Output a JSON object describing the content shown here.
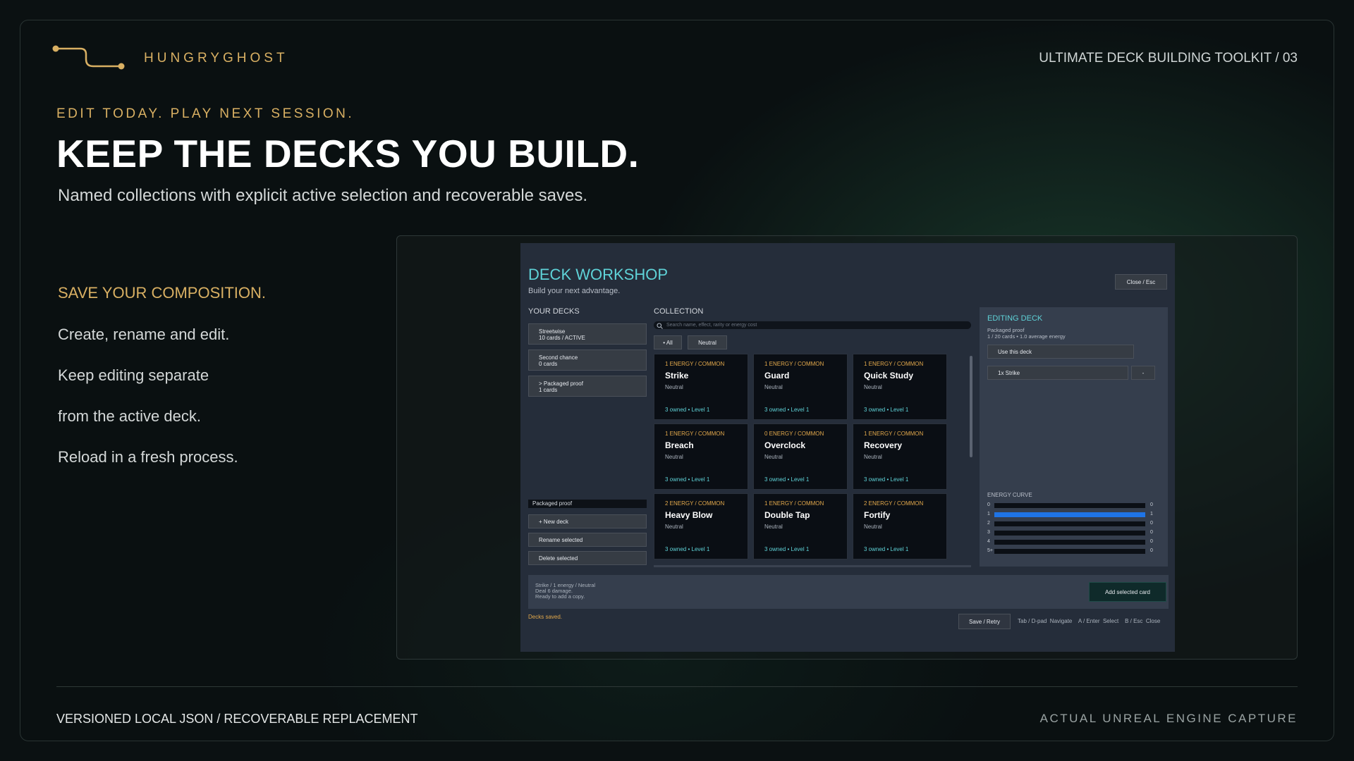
{
  "brand": {
    "name": "HUNGRYGHOST",
    "accent": "#d9b063"
  },
  "header": {
    "toolkit": "ULTIMATE DECK BUILDING TOOLKIT / 03"
  },
  "hero": {
    "eyebrow": "EDIT TODAY. PLAY NEXT SESSION.",
    "headline": "KEEP THE DECKS YOU BUILD.",
    "subhead": "Named collections with explicit active selection and recoverable saves."
  },
  "features": {
    "label": "SAVE YOUR COMPOSITION.",
    "items": [
      "Create, rename and edit.",
      "Keep editing separate",
      "from the active deck.",
      "Reload in a fresh process."
    ]
  },
  "footer": {
    "left": "VERSIONED LOCAL JSON / RECOVERABLE REPLACEMENT",
    "right": "ACTUAL UNREAL ENGINE CAPTURE"
  },
  "ui": {
    "title": "DECK WORKSHOP",
    "subtitle": "Build your next advantage.",
    "close_label": "Close  /  Esc",
    "your_decks_label": "YOUR DECKS",
    "decks": [
      {
        "name": "Streetwise",
        "meta": "10 cards  /  ACTIVE"
      },
      {
        "name": "Second chance",
        "meta": "0 cards"
      },
      {
        "name": "> Packaged proof",
        "meta": "1 cards"
      }
    ],
    "deck_name_value": "Packaged proof",
    "new_deck_label": "+ New deck",
    "rename_label": "Rename selected",
    "delete_label": "Delete selected",
    "collection_label": "COLLECTION",
    "search_placeholder": "Search name, effect, rarity or energy cost",
    "filters": {
      "all": "• All",
      "neutral": "Neutral"
    },
    "cards": [
      {
        "cost": "1 ENERGY  /  COMMON",
        "name": "Strike",
        "affinity": "Neutral",
        "owned": "3 owned  •  Level 1"
      },
      {
        "cost": "1 ENERGY  /  COMMON",
        "name": "Guard",
        "affinity": "Neutral",
        "owned": "3 owned  •  Level 1"
      },
      {
        "cost": "1 ENERGY  /  COMMON",
        "name": "Quick Study",
        "affinity": "Neutral",
        "owned": "3 owned  •  Level 1"
      },
      {
        "cost": "1 ENERGY  /  COMMON",
        "name": "Breach",
        "affinity": "Neutral",
        "owned": "3 owned  •  Level 1"
      },
      {
        "cost": "0 ENERGY  /  COMMON",
        "name": "Overclock",
        "affinity": "Neutral",
        "owned": "3 owned  •  Level 1"
      },
      {
        "cost": "1 ENERGY  /  COMMON",
        "name": "Recovery",
        "affinity": "Neutral",
        "owned": "3 owned  •  Level 1"
      },
      {
        "cost": "2 ENERGY  /  COMMON",
        "name": "Heavy Blow",
        "affinity": "Neutral",
        "owned": "3 owned  •  Level 1"
      },
      {
        "cost": "1 ENERGY  /  COMMON",
        "name": "Double Tap",
        "affinity": "Neutral",
        "owned": "3 owned  •  Level 1"
      },
      {
        "cost": "2 ENERGY  /  COMMON",
        "name": "Fortify",
        "affinity": "Neutral",
        "owned": "3 owned  •  Level 1"
      }
    ],
    "editing": {
      "label": "EDITING DECK",
      "deck_name": "Packaged proof",
      "deck_meta": "1 / 20 cards  •  1.0 average energy",
      "use_label": "Use this deck",
      "entry_label": "1x  Strike",
      "remove_label": "-"
    },
    "energy_curve": {
      "label": "ENERGY CURVE",
      "rows": [
        {
          "cost": "0",
          "count": "0",
          "fill": 0
        },
        {
          "cost": "1",
          "count": "1",
          "fill": 1
        },
        {
          "cost": "2",
          "count": "0",
          "fill": 0
        },
        {
          "cost": "3",
          "count": "0",
          "fill": 0
        },
        {
          "cost": "4",
          "count": "0",
          "fill": 0
        },
        {
          "cost": "5+",
          "count": "0",
          "fill": 0
        }
      ]
    },
    "detail": {
      "line1": "Strike  /  1 energy  /  Neutral",
      "line2": "Deal 6 damage.",
      "line3": "Ready to add a copy."
    },
    "add_label": "Add selected card",
    "status": "Decks saved.",
    "save_label": "Save / Retry",
    "hints": "Tab / D-pad  Navigate    A / Enter  Select    B / Esc  Close"
  }
}
